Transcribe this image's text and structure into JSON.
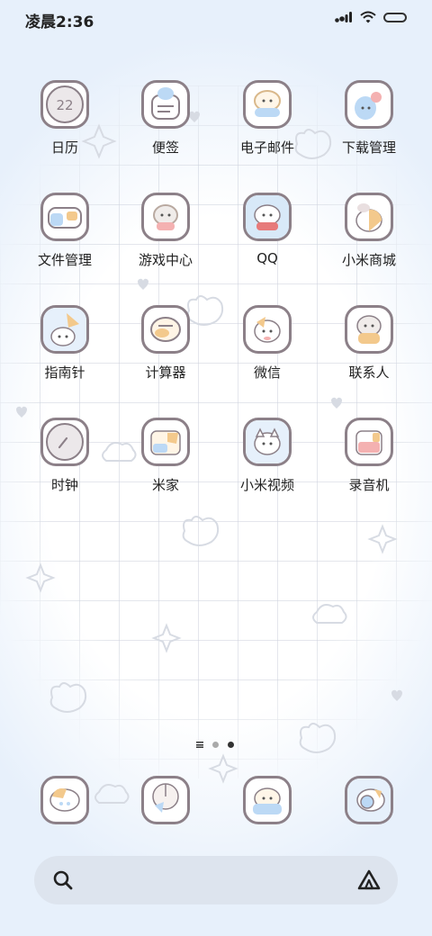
{
  "status_bar": {
    "time": "凌晨2:36",
    "icons": [
      "signal-icon",
      "wifi-icon",
      "battery-icon"
    ]
  },
  "apps": [
    {
      "label": "日历",
      "icon": "calendar-icon"
    },
    {
      "label": "便签",
      "icon": "notes-icon"
    },
    {
      "label": "电子邮件",
      "icon": "email-icon"
    },
    {
      "label": "下载管理",
      "icon": "download-icon"
    },
    {
      "label": "文件管理",
      "icon": "file-manager-icon"
    },
    {
      "label": "游戏中心",
      "icon": "game-center-icon"
    },
    {
      "label": "QQ",
      "icon": "qq-icon"
    },
    {
      "label": "小米商城",
      "icon": "mi-store-icon"
    },
    {
      "label": "指南针",
      "icon": "compass-icon"
    },
    {
      "label": "计算器",
      "icon": "calculator-icon"
    },
    {
      "label": "微信",
      "icon": "wechat-icon"
    },
    {
      "label": "联系人",
      "icon": "contacts-icon"
    },
    {
      "label": "时钟",
      "icon": "clock-icon"
    },
    {
      "label": "米家",
      "icon": "mijia-icon"
    },
    {
      "label": "小米视频",
      "icon": "mi-video-icon"
    },
    {
      "label": "录音机",
      "icon": "recorder-icon"
    }
  ],
  "page_indicator": {
    "pages": 3,
    "current": 3
  },
  "dock": [
    {
      "icon": "phone-icon"
    },
    {
      "icon": "messages-icon"
    },
    {
      "icon": "browser-icon"
    },
    {
      "icon": "camera-icon"
    }
  ],
  "search_bar": {
    "left_icon": "search-icon",
    "right_icon": "assistant-icon"
  },
  "colors": {
    "icon_border": "#8c8088",
    "search_bg": "#dde4ee",
    "accent_blue": "#bcd9f5",
    "accent_orange": "#f3c98c",
    "accent_pink": "#f4b1b1"
  }
}
